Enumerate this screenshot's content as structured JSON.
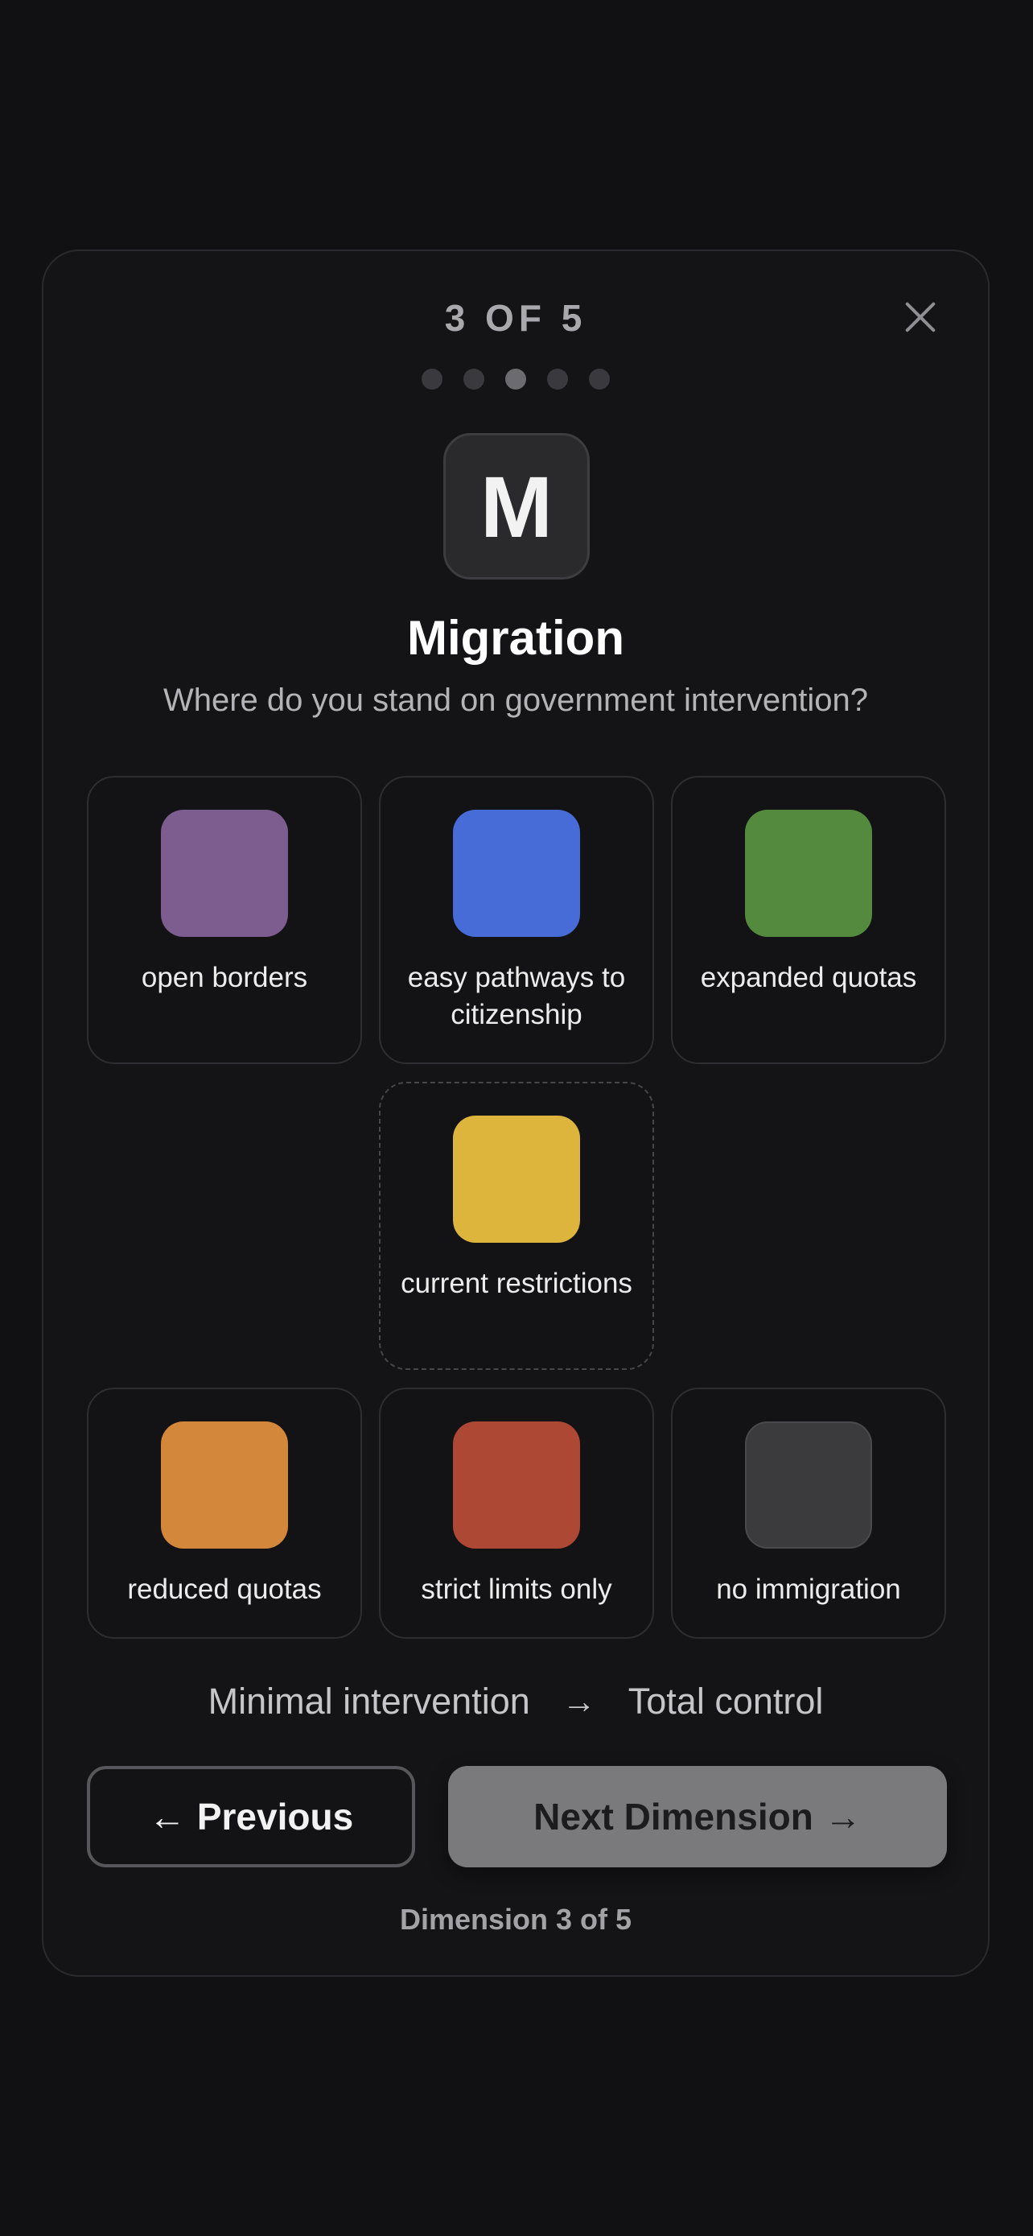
{
  "header": {
    "step_label": "3 OF 5",
    "total_steps": 5,
    "current_step": 3
  },
  "dimension": {
    "icon_letter": "M",
    "title": "Migration",
    "question": "Where do you stand on government intervention?"
  },
  "options": [
    {
      "label": "open borders",
      "color": "#7d5d8f"
    },
    {
      "label": "easy pathways to citizenship",
      "color": "#476bd7"
    },
    {
      "label": "expanded quotas",
      "color": "#548a3d"
    },
    {
      "label": "current restrictions",
      "color": "#deb53c"
    },
    {
      "label": "reduced quotas",
      "color": "#d3873a"
    },
    {
      "label": "strict limits only",
      "color": "#ad4834"
    },
    {
      "label": "no immigration",
      "color": "#3b3b3e"
    }
  ],
  "scale": {
    "left": "Minimal intervention",
    "arrow": "→",
    "right": "Total control"
  },
  "buttons": {
    "previous": "Previous",
    "next": "Next Dimension"
  },
  "footer": "Dimension 3 of 5"
}
